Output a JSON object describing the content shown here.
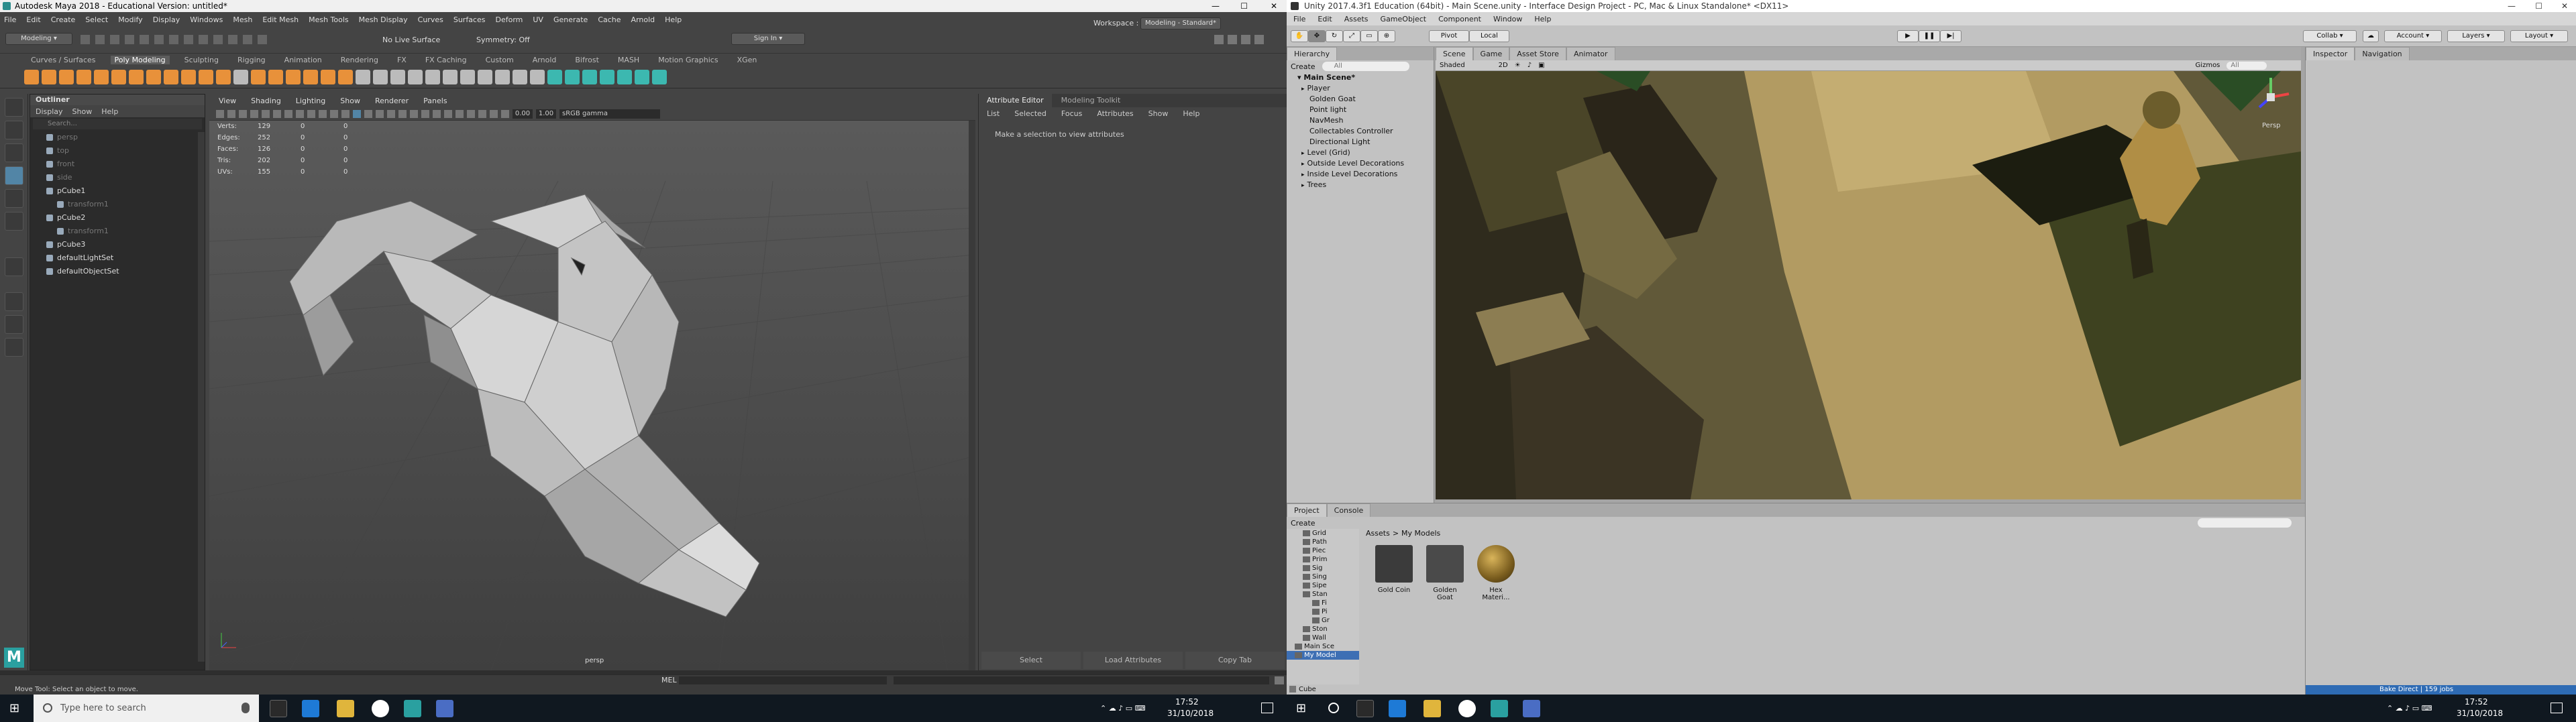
{
  "maya": {
    "title": "Autodesk Maya 2018 - Educational Version: untitled*",
    "menu": [
      "File",
      "Edit",
      "Create",
      "Select",
      "Modify",
      "Display",
      "Windows",
      "Mesh",
      "Edit Mesh",
      "Mesh Tools",
      "Mesh Display",
      "Curves",
      "Surfaces",
      "Deform",
      "UV",
      "Generate",
      "Cache",
      "Arnold",
      "Help"
    ],
    "mode_dropdown": "Modeling",
    "no_live_surface": "No Live Surface",
    "symmetry": "Symmetry: Off",
    "sign_in": "Sign In",
    "workspace_label": "Workspace :",
    "workspace_value": "Modeling - Standard*",
    "shelf_tabs": [
      "Curves / Surfaces",
      "Poly Modeling",
      "Sculpting",
      "Rigging",
      "Animation",
      "Rendering",
      "FX",
      "FX Caching",
      "Custom",
      "Arnold",
      "Bifrost",
      "MASH",
      "Motion Graphics",
      "XGen"
    ],
    "shelf_active": "Poly Modeling",
    "outliner": {
      "title": "Outliner",
      "menu": [
        "Display",
        "Show",
        "Help"
      ],
      "search_placeholder": "Search...",
      "items": [
        {
          "label": "persp",
          "dim": true
        },
        {
          "label": "top",
          "dim": true
        },
        {
          "label": "front",
          "dim": true
        },
        {
          "label": "side",
          "dim": true
        },
        {
          "label": "pCube1",
          "dim": false
        },
        {
          "label": "transform1",
          "dim": true
        },
        {
          "label": "pCube2",
          "dim": false
        },
        {
          "label": "transform1",
          "dim": true
        },
        {
          "label": "pCube3",
          "dim": false
        },
        {
          "label": "defaultLightSet",
          "dim": false
        },
        {
          "label": "defaultObjectSet",
          "dim": false
        }
      ]
    },
    "viewport": {
      "menu": [
        "View",
        "Shading",
        "Lighting",
        "Show",
        "Renderer",
        "Panels"
      ],
      "exposure": "0.00",
      "gamma": "1.00",
      "color_space": "sRGB gamma",
      "camera_label": "persp",
      "hud": [
        {
          "label": "Verts:",
          "a": "129",
          "b": "0",
          "c": "0"
        },
        {
          "label": "Edges:",
          "a": "252",
          "b": "0",
          "c": "0"
        },
        {
          "label": "Faces:",
          "a": "126",
          "b": "0",
          "c": "0"
        },
        {
          "label": "Tris:",
          "a": "202",
          "b": "0",
          "c": "0"
        },
        {
          "label": "UVs:",
          "a": "155",
          "b": "0",
          "c": "0"
        }
      ]
    },
    "attribute_editor": {
      "tabs": [
        "Attribute Editor",
        "Modeling Toolkit"
      ],
      "menu": [
        "List",
        "Selected",
        "Focus",
        "Attributes",
        "Show",
        "Help"
      ],
      "message": "Make a selection to view attributes",
      "buttons": [
        "Select",
        "Load Attributes",
        "Copy Tab"
      ]
    },
    "command_line_label": "MEL",
    "help_line": "Move Tool: Select an object to move."
  },
  "unity": {
    "title": "Unity 2017.4.3f1 Education (64bit) - Main Scene.unity - Interface Design Project - PC, Mac & Linux Standalone* <DX11>",
    "menu": [
      "File",
      "Edit",
      "Assets",
      "GameObject",
      "Component",
      "Window",
      "Help"
    ],
    "pivot": "Pivot",
    "local": "Local",
    "collab": "Collab",
    "account": "Account",
    "layers": "Layers",
    "layout": "Layout",
    "hierarchy": {
      "tab": "Hierarchy",
      "create": "Create",
      "search_placeholder": "All",
      "scene": "Main Scene*",
      "items": [
        "Player",
        "Golden Goat",
        "Point light",
        "NavMesh",
        "Collectables Controller",
        "Directional Light",
        "Level (Grid)",
        "Outside Level Decorations",
        "Inside Level Decorations",
        "Trees"
      ]
    },
    "scene_tabs": [
      "Scene",
      "Game",
      "Asset Store",
      "Animator"
    ],
    "scene_bar": {
      "shading": "Shaded",
      "mode": "2D",
      "gizmos": "Gizmos",
      "search": "All"
    },
    "scene_gizmo_label": "Persp",
    "inspector_tabs": [
      "Inspector",
      "Navigation"
    ],
    "project_tabs": [
      "Project",
      "Console"
    ],
    "project_create": "Create",
    "project_tree": [
      "Grid",
      "Path",
      "Piec",
      "Prim",
      "Sig",
      "Sing",
      "Sipe",
      "Stan",
      "Fi",
      "Pi",
      "Gr",
      "Ston",
      "Wall",
      "Main Sce",
      "My Model"
    ],
    "breadcrumb": [
      "Assets",
      "My Models"
    ],
    "assets": [
      "Gold Coin",
      "Golden Goat",
      "Hex Materi..."
    ],
    "status_right": "Bake Direct | 159 jobs",
    "cube_label": "Cube"
  },
  "taskbar": {
    "search_placeholder": "Type here to search",
    "time": "17:52",
    "date": "31/10/2018"
  },
  "colors": {
    "maya_bg": "#444444",
    "maya_accent": "#5285a6",
    "unity_bg": "#c2c2c2",
    "taskbar": "#101820"
  }
}
